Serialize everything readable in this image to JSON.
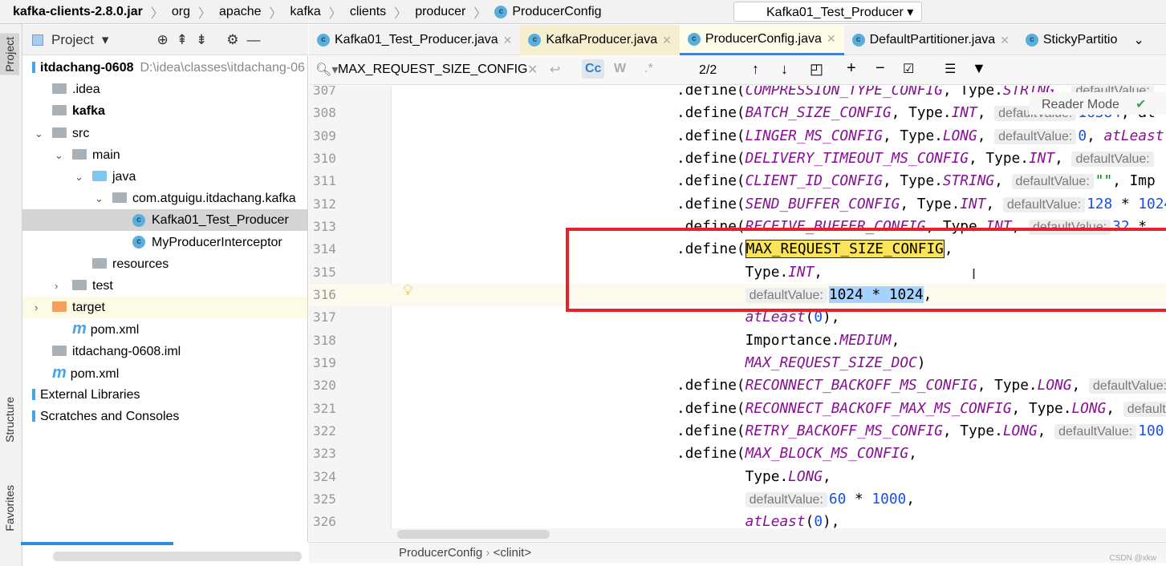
{
  "breadcrumb": [
    "kafka-clients-2.8.0.jar",
    "org",
    "apache",
    "kafka",
    "clients",
    "producer",
    "ProducerConfig"
  ],
  "run_config": "Kafka01_Test_Producer",
  "side_strip": {
    "project": "Project",
    "structure": "Structure",
    "favorites": "Favorites"
  },
  "project_panel": {
    "title": "Project",
    "tree": [
      {
        "label": "itdachang-0608",
        "extra": "D:\\idea\\classes\\itdachang-06",
        "depth": 0,
        "bold": true,
        "icon": "module-icon"
      },
      {
        "label": ".idea",
        "depth": 1,
        "icon": "folder-icon"
      },
      {
        "label": "kafka",
        "depth": 1,
        "bold": true,
        "icon": "module-folder-icon"
      },
      {
        "label": "src",
        "depth": 1,
        "open": true,
        "icon": "folder-icon"
      },
      {
        "label": "main",
        "depth": 2,
        "open": true,
        "icon": "folder-icon"
      },
      {
        "label": "java",
        "depth": 3,
        "open": true,
        "icon": "source-folder-icon"
      },
      {
        "label": "com.atguigu.itdachang.kafka",
        "depth": 4,
        "open": true,
        "icon": "package-icon"
      },
      {
        "label": "Kafka01_Test_Producer",
        "depth": 5,
        "icon": "class-icon",
        "selected": true
      },
      {
        "label": "MyProducerInterceptor",
        "depth": 5,
        "icon": "class-icon"
      },
      {
        "label": "resources",
        "depth": 3,
        "icon": "resources-folder-icon"
      },
      {
        "label": "test",
        "depth": 2,
        "closed": true,
        "icon": "folder-icon"
      },
      {
        "label": "target",
        "depth": 1,
        "closed": true,
        "icon": "excluded-folder-icon",
        "highlight": true
      },
      {
        "label": "pom.xml",
        "depth": 2,
        "icon": "maven-icon"
      },
      {
        "label": "itdachang-0608.iml",
        "depth": 1,
        "icon": "iml-icon"
      },
      {
        "label": "pom.xml",
        "depth": 1,
        "icon": "maven-icon"
      },
      {
        "label": "External Libraries",
        "depth": 0,
        "icon": "library-icon"
      },
      {
        "label": "Scratches and Consoles",
        "depth": 0,
        "icon": "scratches-icon"
      }
    ]
  },
  "tabs": [
    {
      "label": "Kafka01_Test_Producer.java"
    },
    {
      "label": "KafkaProducer.java",
      "style": "yel"
    },
    {
      "label": "ProducerConfig.java",
      "active": true
    },
    {
      "label": "DefaultPartitioner.java"
    },
    {
      "label": "StickyPartitio"
    }
  ],
  "find": {
    "query": "MAX_REQUEST_SIZE_CONFIG",
    "match_case": "Cc",
    "words": "W",
    "regex": ".*",
    "count": "2/2"
  },
  "reader_mode": "Reader Mode",
  "code": [
    {
      "n": "307",
      "t": [
        [
          "p",
          ".define("
        ],
        [
          "c",
          "COMPRESSION_TYPE_CONFIG"
        ],
        [
          "p",
          ", Type."
        ],
        [
          "c",
          "STRING"
        ],
        [
          "p",
          ", "
        ],
        [
          "h",
          "defaultValue:"
        ]
      ]
    },
    {
      "n": "308",
      "t": [
        [
          "p",
          ".define("
        ],
        [
          "c",
          "BATCH_SIZE_CONFIG"
        ],
        [
          "p",
          ", Type."
        ],
        [
          "c",
          "INT"
        ],
        [
          "p",
          ", "
        ],
        [
          "h",
          "defaultValue:"
        ],
        [
          "n",
          "16384"
        ],
        [
          "p",
          ", at"
        ]
      ]
    },
    {
      "n": "309",
      "t": [
        [
          "p",
          ".define("
        ],
        [
          "c",
          "LINGER_MS_CONFIG"
        ],
        [
          "p",
          ", Type."
        ],
        [
          "c",
          "LONG"
        ],
        [
          "p",
          ", "
        ],
        [
          "h",
          "defaultValue:"
        ],
        [
          "n",
          "0"
        ],
        [
          "p",
          ", "
        ],
        [
          "c",
          "atLeast"
        ]
      ]
    },
    {
      "n": "310",
      "t": [
        [
          "p",
          ".define("
        ],
        [
          "c",
          "DELIVERY_TIMEOUT_MS_CONFIG"
        ],
        [
          "p",
          ", Type."
        ],
        [
          "c",
          "INT"
        ],
        [
          "p",
          ", "
        ],
        [
          "h",
          "defaultValue:"
        ]
      ]
    },
    {
      "n": "311",
      "t": [
        [
          "p",
          ".define("
        ],
        [
          "c",
          "CLIENT_ID_CONFIG"
        ],
        [
          "p",
          ", Type."
        ],
        [
          "c",
          "STRING"
        ],
        [
          "p",
          ", "
        ],
        [
          "h",
          "defaultValue:"
        ],
        [
          "s",
          "\"\""
        ],
        [
          "p",
          ", Imp"
        ]
      ]
    },
    {
      "n": "312",
      "t": [
        [
          "p",
          ".define("
        ],
        [
          "c",
          "SEND_BUFFER_CONFIG"
        ],
        [
          "p",
          ", Type."
        ],
        [
          "c",
          "INT"
        ],
        [
          "p",
          ", "
        ],
        [
          "h",
          "defaultValue:"
        ],
        [
          "n",
          "128"
        ],
        [
          "p",
          " * "
        ],
        [
          "n",
          "1024"
        ]
      ]
    },
    {
      "n": "313",
      "t": [
        [
          "p",
          ".define("
        ],
        [
          "c",
          "RECEIVE_BUFFER_CONFIG"
        ],
        [
          "p",
          ", Type."
        ],
        [
          "c",
          "INT"
        ],
        [
          "p",
          ", "
        ],
        [
          "h",
          "defaultValue:"
        ],
        [
          "n",
          "32"
        ],
        [
          "p",
          " *"
        ]
      ]
    },
    {
      "n": "314",
      "t": [
        [
          "p",
          ".define("
        ],
        [
          "m",
          "MAX_REQUEST_SIZE_CONFIG"
        ],
        [
          "p",
          ","
        ]
      ]
    },
    {
      "n": "315",
      "t": [
        [
          "p",
          "        Type."
        ],
        [
          "c",
          "INT"
        ],
        [
          "p",
          ","
        ]
      ]
    },
    {
      "n": "316",
      "cur": true,
      "t": [
        [
          "p",
          "        "
        ],
        [
          "h",
          "defaultValue:"
        ],
        [
          "sel",
          "1024 * 1024"
        ],
        [
          "p",
          ","
        ]
      ]
    },
    {
      "n": "317",
      "t": [
        [
          "p",
          "        "
        ],
        [
          "c",
          "atLeast"
        ],
        [
          "p",
          "("
        ],
        [
          "n",
          "0"
        ],
        [
          "p",
          "),"
        ]
      ]
    },
    {
      "n": "318",
      "t": [
        [
          "p",
          "        Importance."
        ],
        [
          "c",
          "MEDIUM"
        ],
        [
          "p",
          ","
        ]
      ]
    },
    {
      "n": "319",
      "t": [
        [
          "p",
          "        "
        ],
        [
          "c",
          "MAX_REQUEST_SIZE_DOC"
        ],
        [
          "p",
          ")"
        ]
      ]
    },
    {
      "n": "320",
      "t": [
        [
          "p",
          ".define("
        ],
        [
          "c",
          "RECONNECT_BACKOFF_MS_CONFIG"
        ],
        [
          "p",
          ", Type."
        ],
        [
          "c",
          "LONG"
        ],
        [
          "p",
          ", "
        ],
        [
          "h",
          "defaultValue:"
        ]
      ]
    },
    {
      "n": "321",
      "t": [
        [
          "p",
          ".define("
        ],
        [
          "c",
          "RECONNECT_BACKOFF_MAX_MS_CONFIG"
        ],
        [
          "p",
          ", Type."
        ],
        [
          "c",
          "LONG"
        ],
        [
          "p",
          ", "
        ],
        [
          "h",
          "defaultValue:"
        ]
      ]
    },
    {
      "n": "322",
      "t": [
        [
          "p",
          ".define("
        ],
        [
          "c",
          "RETRY_BACKOFF_MS_CONFIG"
        ],
        [
          "p",
          ", Type."
        ],
        [
          "c",
          "LONG"
        ],
        [
          "p",
          ", "
        ],
        [
          "h",
          "defaultValue:"
        ],
        [
          "n",
          "100"
        ]
      ]
    },
    {
      "n": "323",
      "t": [
        [
          "p",
          ".define("
        ],
        [
          "c",
          "MAX_BLOCK_MS_CONFIG"
        ],
        [
          "p",
          ","
        ]
      ]
    },
    {
      "n": "324",
      "t": [
        [
          "p",
          "        Type."
        ],
        [
          "c",
          "LONG"
        ],
        [
          "p",
          ","
        ]
      ]
    },
    {
      "n": "325",
      "t": [
        [
          "p",
          "        "
        ],
        [
          "h",
          "defaultValue:"
        ],
        [
          "n",
          "60"
        ],
        [
          "p",
          " * "
        ],
        [
          "n",
          "1000"
        ],
        [
          "p",
          ","
        ]
      ]
    },
    {
      "n": "326",
      "t": [
        [
          "p",
          "        "
        ],
        [
          "c",
          "atLeast"
        ],
        [
          "p",
          "("
        ],
        [
          "n",
          "0"
        ],
        [
          "p",
          "),"
        ]
      ]
    }
  ],
  "status_breadcrumb": [
    "ProducerConfig",
    "<clinit>"
  ],
  "watermark": "CSDN @xkw",
  "colors": {
    "highlight_box": "#e8202a",
    "search_match": "#fbe35a",
    "selection": "#a6d2ff",
    "constant": "#871094",
    "number": "#1750eb"
  }
}
